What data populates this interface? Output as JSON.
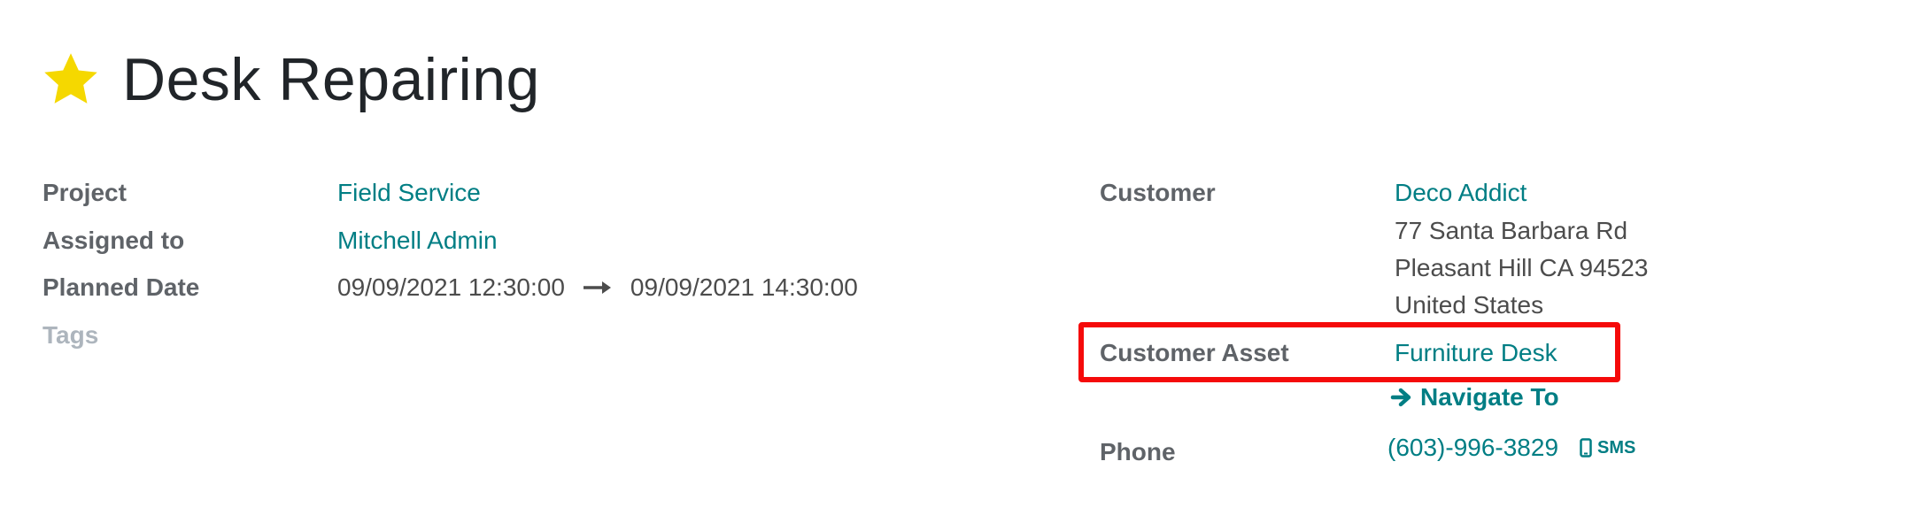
{
  "header": {
    "title": "Desk Repairing",
    "star_icon": "star-icon",
    "star_color": "#f5d800"
  },
  "left_fields": {
    "project_label": "Project",
    "project_value": "Field Service",
    "assigned_label": "Assigned to",
    "assigned_value": "Mitchell Admin",
    "planned_label": "Planned Date",
    "planned_start": "09/09/2021 12:30:00",
    "planned_end": "09/09/2021 14:30:00",
    "arrow_icon": "arrow-right-icon",
    "tags_label": "Tags"
  },
  "right_fields": {
    "customer_label": "Customer",
    "customer_name": "Deco Addict",
    "address": [
      "77 Santa Barbara Rd",
      "Pleasant Hill CA 94523",
      "United States"
    ],
    "asset_label": "Customer Asset",
    "asset_value": "Furniture Desk",
    "navigate_label": "Navigate To",
    "navigate_icon": "arrow-right-icon",
    "phone_label": "Phone",
    "phone_value": "(603)-996-3829",
    "sms_label": "SMS",
    "sms_icon": "mobile-phone-icon"
  },
  "colors": {
    "link": "#017e84",
    "label": "#5f6368",
    "highlight": "#f50a0a"
  }
}
